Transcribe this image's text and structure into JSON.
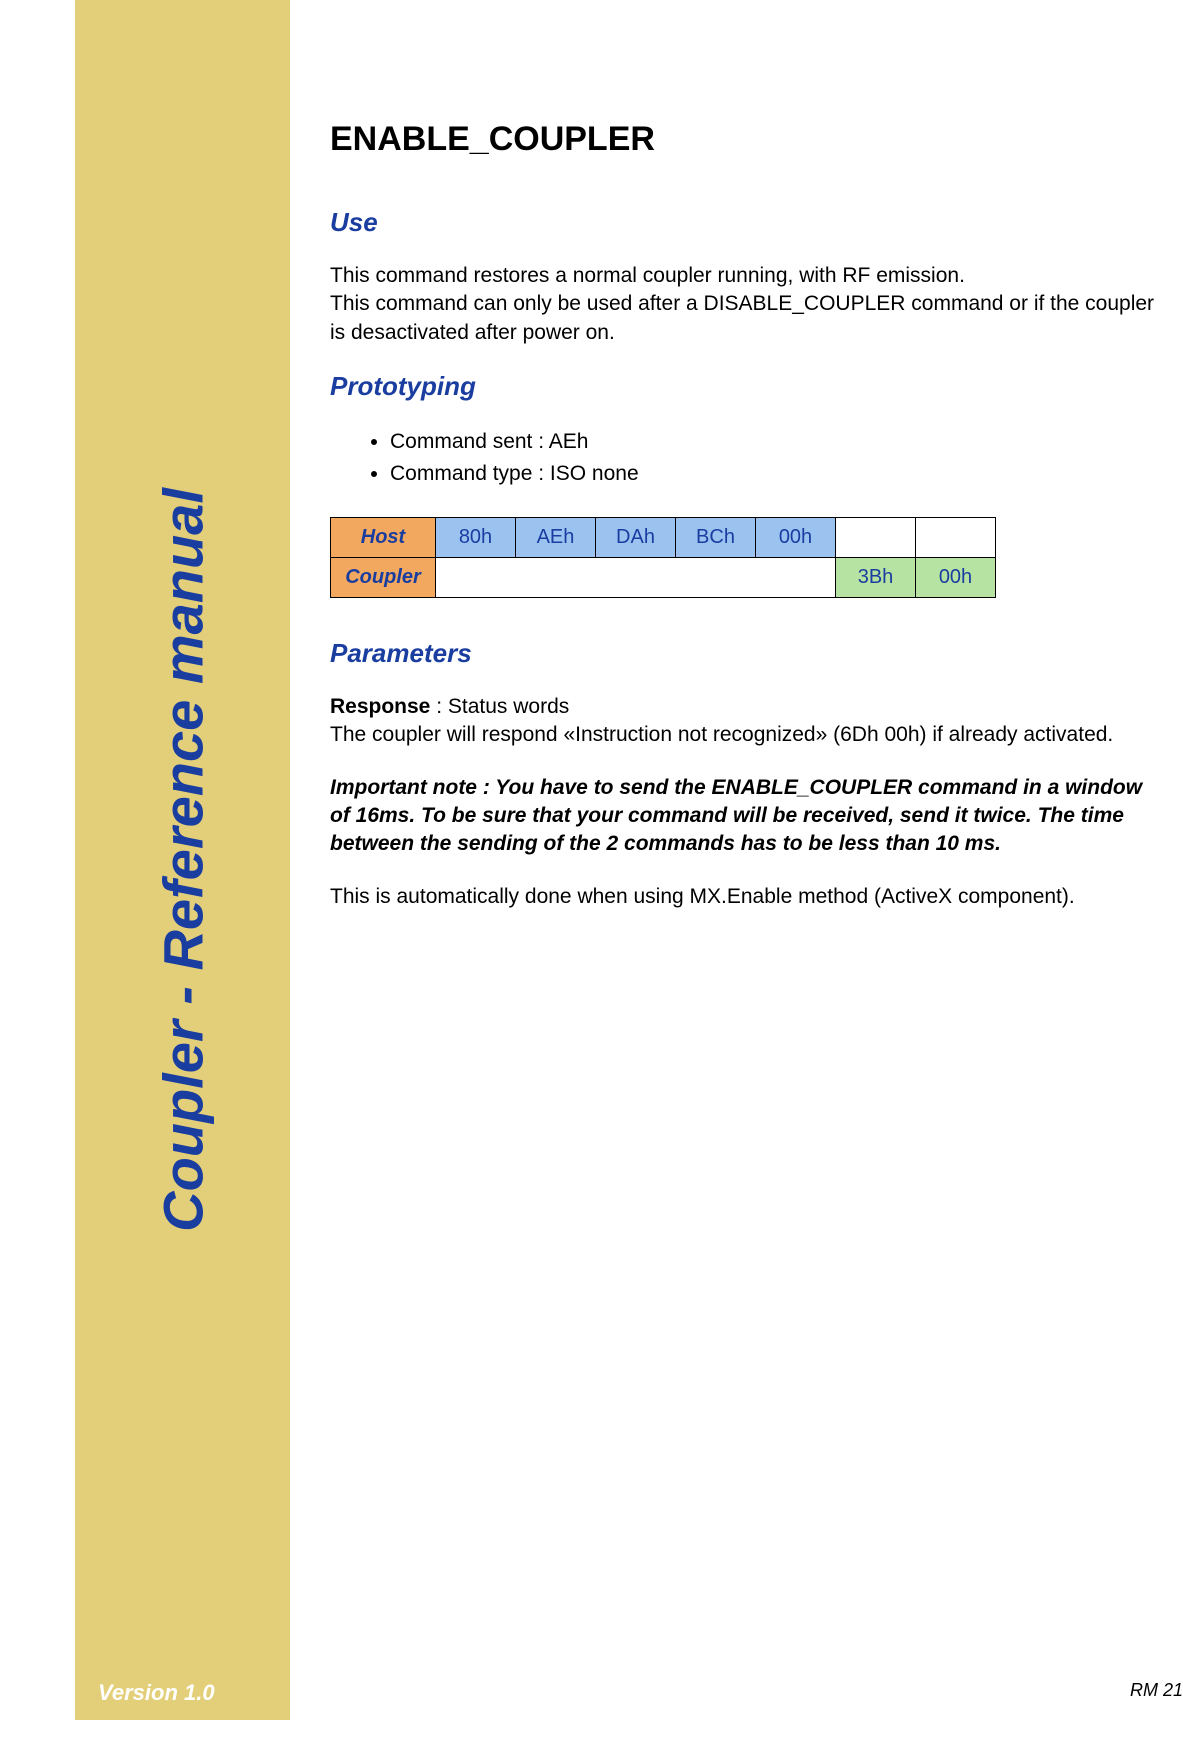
{
  "sidebar": {
    "title": "Coupler - Reference manual",
    "version": "Version 1.0"
  },
  "footer": {
    "page": "RM 21"
  },
  "content": {
    "title": "ENABLE_COUPLER",
    "use": {
      "heading": "Use",
      "p1": "This command restores a normal coupler running, with RF emission.",
      "p2": "This command can only be used after a DISABLE_COUPLER command or if the coupler is desactivated after power on."
    },
    "prototyping": {
      "heading": "Prototyping",
      "items": [
        "Command sent : AEh",
        "Command type : ISO none"
      ],
      "table": {
        "host_label": "Host",
        "coupler_label": "Coupler",
        "host_values": [
          "80h",
          "AEh",
          "DAh",
          "BCh",
          "00h"
        ],
        "coupler_values": [
          "3Bh",
          "00h"
        ]
      }
    },
    "parameters": {
      "heading": "Parameters",
      "response_label": "Response",
      "response_text": " : Status words",
      "p2": "The coupler will respond «Instruction not recognized» (6Dh 00h) if already activated.",
      "note": "Important note : You have to send the ENABLE_COUPLER command in a window of 16ms. To be sure that your command will be received, send it twice. The time between the sending of the 2 commands has to be less than 10 ms.",
      "p3": "This is automatically done when using MX.Enable method (ActiveX component)."
    }
  }
}
